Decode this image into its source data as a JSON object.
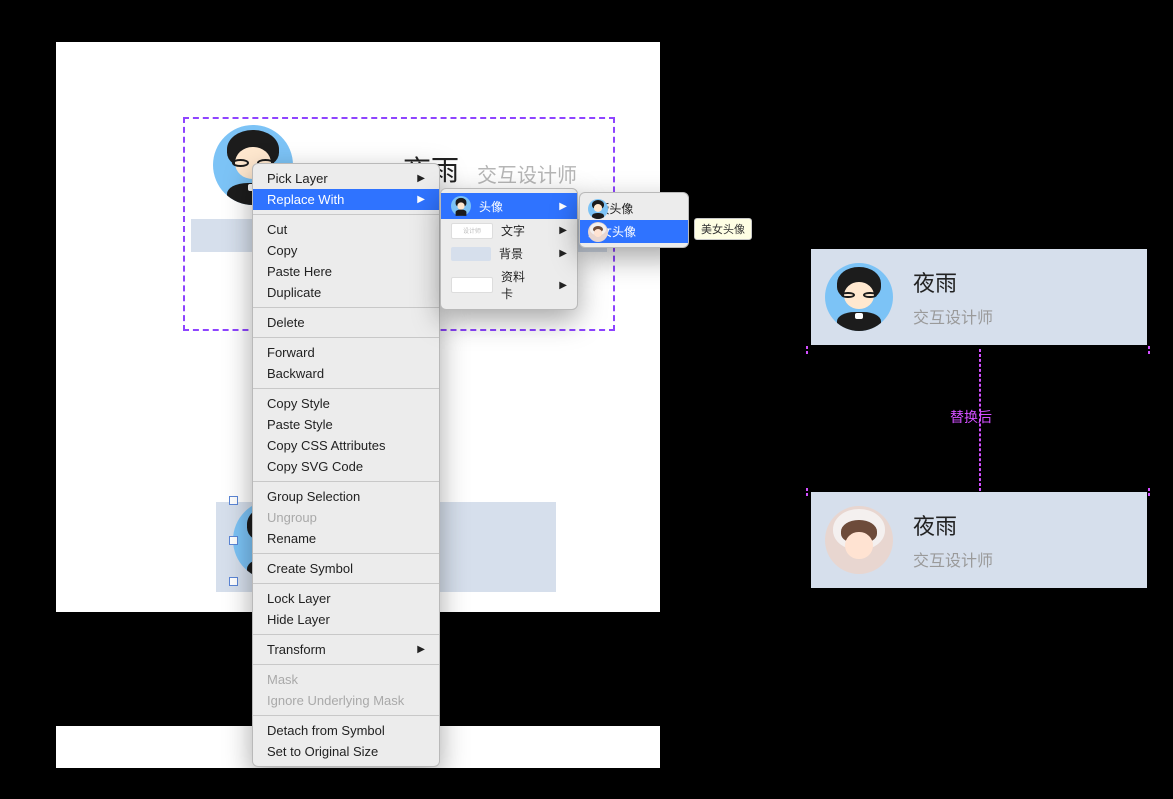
{
  "profile": {
    "name": "夜雨",
    "role": "交互设计师"
  },
  "menu": {
    "pickLayer": "Pick Layer",
    "replaceWith": "Replace With",
    "cut": "Cut",
    "copy": "Copy",
    "pasteHere": "Paste Here",
    "duplicate": "Duplicate",
    "delete": "Delete",
    "forward": "Forward",
    "backward": "Backward",
    "copyStyle": "Copy Style",
    "pasteStyle": "Paste Style",
    "copyCSS": "Copy CSS Attributes",
    "copySVG": "Copy SVG Code",
    "groupSelection": "Group Selection",
    "ungroup": "Ungroup",
    "rename": "Rename",
    "createSymbol": "Create Symbol",
    "lockLayer": "Lock Layer",
    "hideLayer": "Hide Layer",
    "transform": "Transform",
    "mask": "Mask",
    "ignoreMask": "Ignore Underlying Mask",
    "detach": "Detach from Symbol",
    "setOriginal": "Set to Original Size"
  },
  "submenu1": {
    "avatar": "头像",
    "text": "文字",
    "bg": "背景",
    "card": "资料卡"
  },
  "submenu2": {
    "qAvatar": "Q版头像",
    "girlAvatar": "美女头像"
  },
  "tooltip": "美女头像",
  "replaceLabel": "替换后"
}
